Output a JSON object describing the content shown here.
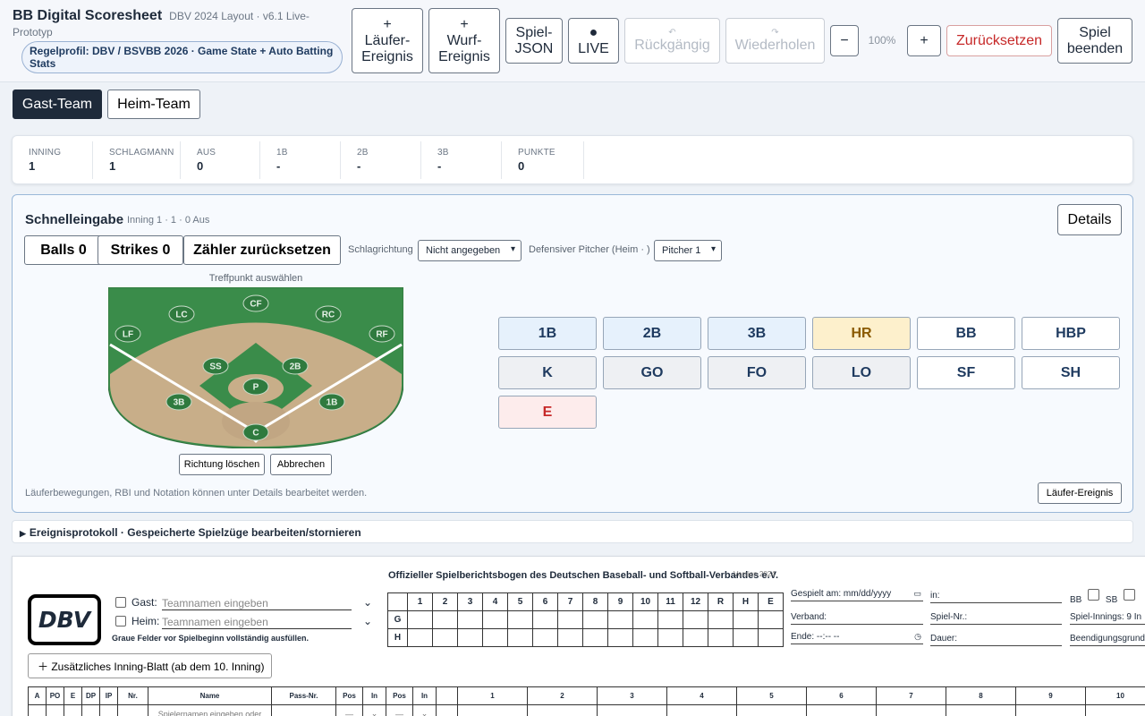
{
  "header": {
    "title": "BB Digital Scoresheet",
    "subtitle": "DBV 2024 Layout · v6.1 Live-Prototyp",
    "rule_profile": "Regelprofil: DBV / BSVBB 2026 · Game State + Auto Batting Stats",
    "buttons": {
      "runner_event": "+\nLäufer-\nEreignis",
      "pitch_event": "+\nWurf-\nEreignis",
      "game_json": "Spiel-\nJSON",
      "live": "●\nLIVE",
      "undo_icon": "↶",
      "undo": "Rückgängig",
      "redo_icon": "↷",
      "redo": "Wiederholen",
      "zoom_out": "−",
      "zoom_level": "100%",
      "zoom_in": "+",
      "reset": "Zurücksetzen",
      "end_game": "Spiel\nbeenden"
    }
  },
  "teams": {
    "away": "Gast-Team",
    "home": "Heim-Team",
    "active": "away"
  },
  "state": [
    {
      "label": "INNING",
      "value": "1"
    },
    {
      "label": "SCHLAGMANN",
      "value": "1"
    },
    {
      "label": "AUS",
      "value": "0"
    },
    {
      "label": "1B",
      "value": "-"
    },
    {
      "label": "2B",
      "value": "-"
    },
    {
      "label": "3B",
      "value": "-"
    },
    {
      "label": "PUNKTE",
      "value": "0"
    }
  ],
  "quick": {
    "title": "Schnelleingabe",
    "subtitle": "Inning 1 · 1 · 0 Aus",
    "details": "Details",
    "balls": "Balls 0",
    "strikes": "Strikes 0",
    "reset_count": "Zähler zurücksetzen",
    "direction_label": "Schlagrichtung",
    "direction_value": "Nicht angegeben",
    "pitcher_label": "Defensiver Pitcher (Heim · )",
    "pitcher_value": "Pitcher 1",
    "field_hint": "Treffpunkt auswählen",
    "positions": [
      "LF",
      "LC",
      "CF",
      "RC",
      "RF",
      "SS",
      "2B",
      "P",
      "3B",
      "1B",
      "C"
    ],
    "clear_direction": "Richtung löschen",
    "cancel": "Abbrechen",
    "note": "Läuferbewegungen, RBI und Notation können unter Details bearbeitet werden.",
    "runner_event": "Läufer-Ereignis",
    "results": [
      "1B",
      "2B",
      "3B",
      "HR",
      "BB",
      "HBP",
      "K",
      "GO",
      "FO",
      "LO",
      "SF",
      "SH",
      "E"
    ],
    "colors": {
      "hit": "#e6f1fc",
      "hr": "#fdf0cc",
      "walk": "#ffffff",
      "out": "#eef0f3",
      "error": "#fdecec",
      "hr_text": "#8a5a00",
      "error_text": "#c62828"
    }
  },
  "event_log": "Ereignisprotokoll · Gespeicherte Spielzüge bearbeiten/stornieren",
  "sheet": {
    "title": "Offizieller Spielberichtsbogen des Deutschen Baseball- und Softball-Verbandes e.V.",
    "version": "Version 2024",
    "logo": "DBV",
    "away_label": "Gast:",
    "home_label": "Heim:",
    "team_placeholder": "Teamnamen eingeben",
    "dropdown_icon": "⌄",
    "grey_note": "Graue Felder vor Spielbeginn vollständig ausfüllen.",
    "innings": [
      "1",
      "2",
      "3",
      "4",
      "5",
      "6",
      "7",
      "8",
      "9",
      "10",
      "11",
      "12",
      "R",
      "H",
      "E"
    ],
    "rows": [
      "G",
      "H"
    ],
    "meta": {
      "played_on": "Gespielt am:",
      "date_placeholder": "mm/dd/yyyy",
      "in": "in:",
      "bb": "BB",
      "sb": "SB",
      "association": "Verband:",
      "game_no": "Spiel-Nr.:",
      "game_innings": "Spiel-Innings:",
      "game_innings_value": "9 In",
      "end": "Ende:",
      "time_placeholder": "--:-- --",
      "duration": "Dauer:",
      "termination": "Beendigungsgrund"
    },
    "extra_inning": "＋ Zusätzliches Inning-Blatt (ab dem 10. Inning)",
    "roster_headers": [
      "A",
      "PO",
      "E",
      "DP",
      "IP",
      "Nr.",
      "Name",
      "Pass-Nr.",
      "Pos",
      "In",
      "Pos",
      "In",
      "",
      "1",
      "2",
      "3",
      "4",
      "5",
      "6",
      "7",
      "8",
      "9",
      "10"
    ],
    "player_placeholder": "Spielernamen eingeben oder",
    "dash": "—"
  }
}
